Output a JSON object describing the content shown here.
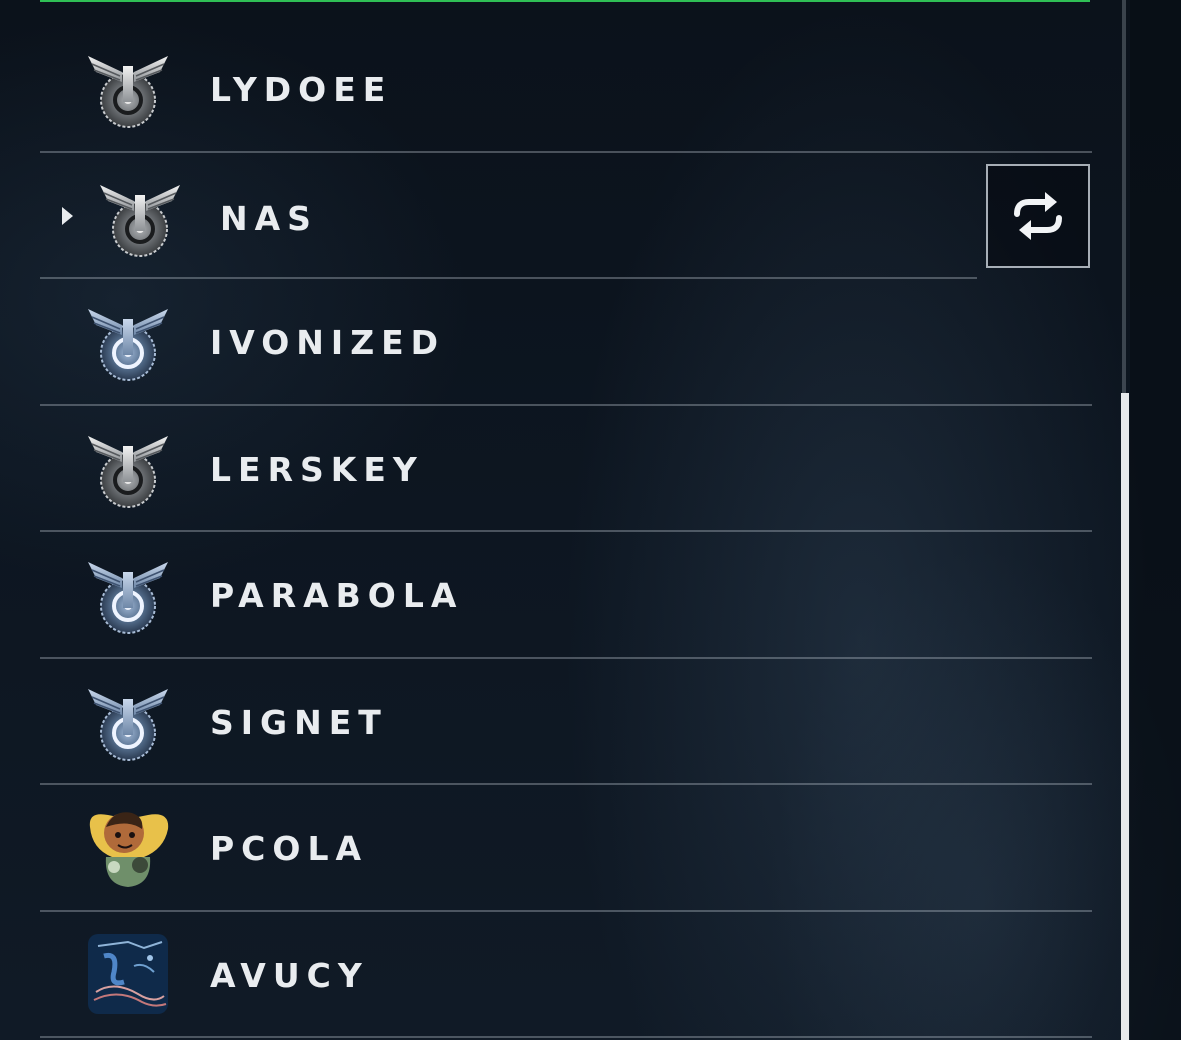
{
  "accent_color": "#2fbf55",
  "players": [
    {
      "name": "LYDOEE",
      "emblem": "silver-winged-wheel-icon",
      "selected": false
    },
    {
      "name": "NAS",
      "emblem": "silver-winged-wheel-icon",
      "selected": true
    },
    {
      "name": "IVONIZED",
      "emblem": "blue-winged-wheel-icon",
      "selected": false
    },
    {
      "name": "LERSKEY",
      "emblem": "silver-winged-wheel-icon",
      "selected": false
    },
    {
      "name": "PARABOLA",
      "emblem": "blue-winged-wheel-icon",
      "selected": false
    },
    {
      "name": "SIGNET",
      "emblem": "blue-winged-wheel-icon",
      "selected": false
    },
    {
      "name": "PCOLA",
      "emblem": "cartoon-character-icon",
      "selected": false
    },
    {
      "name": "AVUCY",
      "emblem": "blue-abstract-art-icon",
      "selected": false
    }
  ],
  "actions": {
    "swap_icon": "swap-arrows-icon"
  }
}
